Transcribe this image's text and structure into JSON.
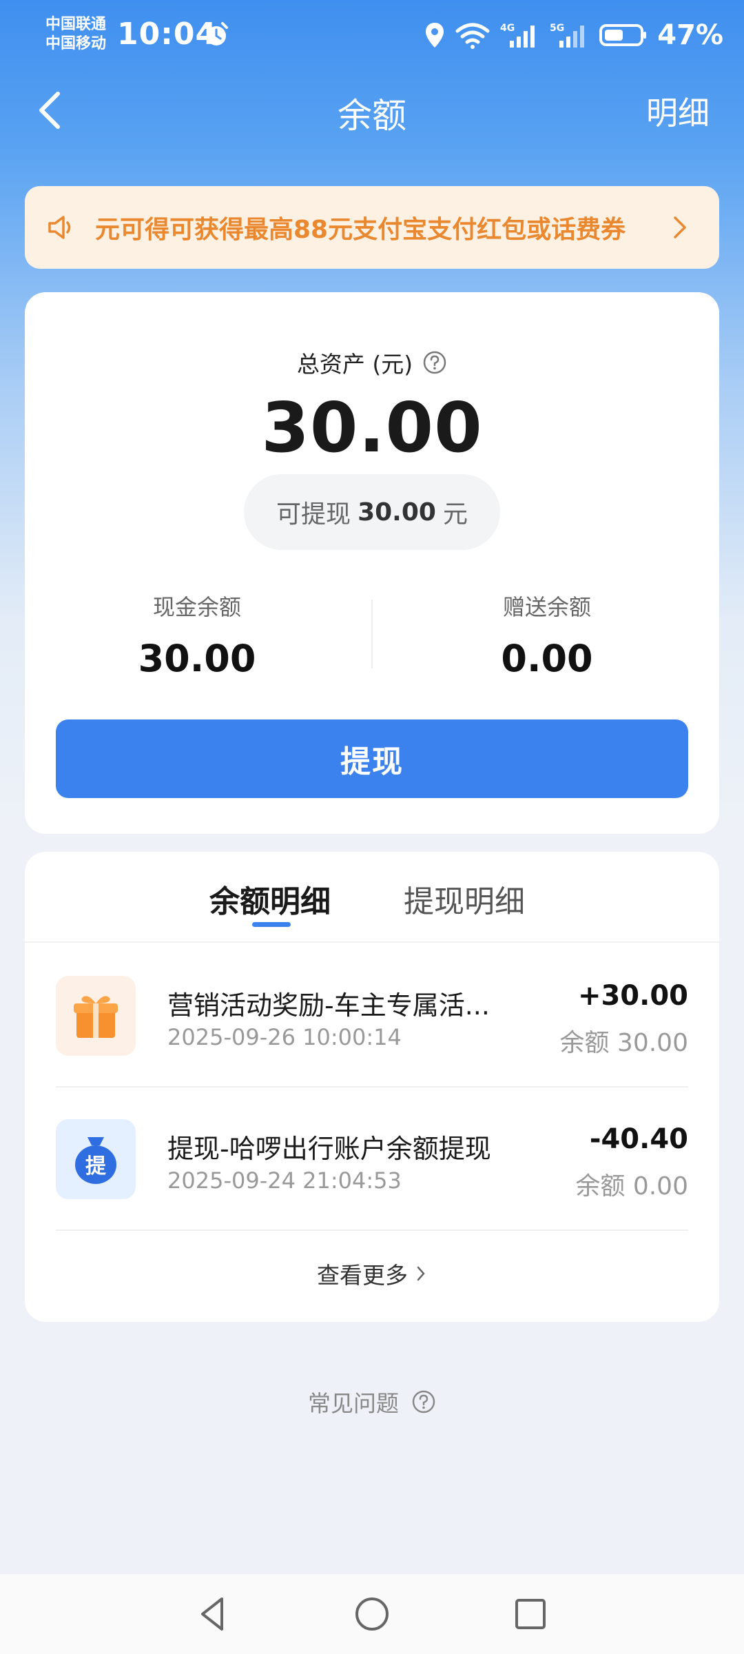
{
  "status_bar": {
    "carrier_1": "中国联通",
    "carrier_2": "中国移动",
    "time": "10:04",
    "battery": "47%",
    "icons": [
      "alarm-icon",
      "location-icon",
      "wifi-icon",
      "signal-4g-icon",
      "signal-5g-icon",
      "battery-icon"
    ]
  },
  "nav": {
    "title": "余额",
    "detail_label": "明细"
  },
  "banner": {
    "text": "元可得可获得最高88元支付宝支付红包或话费券",
    "icons": [
      "speaker-icon",
      "chevron-right-icon"
    ]
  },
  "balance": {
    "total_label": "总资产 (元)",
    "total_amount": "30.00",
    "withdrawable_prefix": "可提现",
    "withdrawable_amount": "30.00",
    "withdrawable_unit": "元",
    "cash_label": "现金余额",
    "cash_value": "30.00",
    "bonus_label": "赠送余额",
    "bonus_value": "0.00",
    "withdraw_button": "提现"
  },
  "records": {
    "tabs": [
      {
        "label": "余额明细",
        "active": true
      },
      {
        "label": "提现明细",
        "active": false
      }
    ],
    "items": [
      {
        "icon": "gift-icon",
        "title": "营销活动奖励-车主专属活...",
        "time": "2025-09-26 10:00:14",
        "amount": "+30.00",
        "balance": "余额 30.00"
      },
      {
        "icon": "money-bag-icon",
        "icon_text": "提",
        "title": "提现-哈啰出行账户余额提现",
        "time": "2025-09-24 21:04:53",
        "amount": "-40.40",
        "balance": "余额 0.00"
      }
    ],
    "see_more": "查看更多"
  },
  "faq_label": "常见问题",
  "colors": {
    "primary": "#3b82ef",
    "banner_bg": "#fdf1e4",
    "banner_text": "#e9882f"
  }
}
